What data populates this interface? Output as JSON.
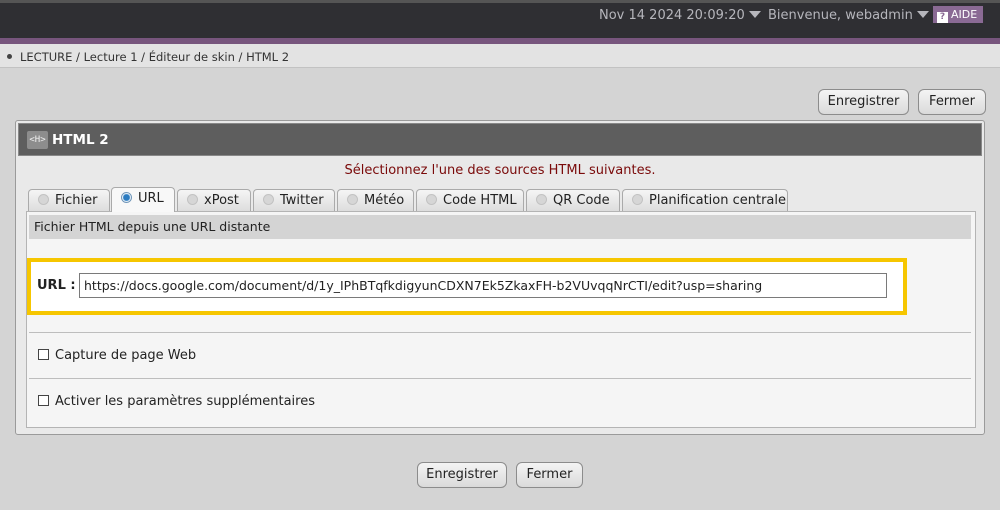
{
  "header": {
    "datetime": "Nov 14 2024 20:09:20",
    "welcome": "Bienvenue, webadmin",
    "help_label": "AIDE",
    "help_icon": "?"
  },
  "breadcrumb": "LECTURE / Lecture 1 / Éditeur de skin / HTML 2",
  "toolbar": {
    "save_label": "Enregistrer",
    "close_label": "Fermer"
  },
  "panel": {
    "icon_text": "<H>",
    "title": "HTML 2",
    "notice": "Sélectionnez l'une des sources HTML suivantes.",
    "tabs": [
      {
        "label": "Fichier"
      },
      {
        "label": "URL"
      },
      {
        "label": "xPost"
      },
      {
        "label": "Twitter"
      },
      {
        "label": "Météo"
      },
      {
        "label": "Code HTML"
      },
      {
        "label": "QR Code"
      },
      {
        "label": "Planification centrale"
      }
    ],
    "active_tab": "URL",
    "section_title": "Fichier HTML depuis une URL distante",
    "url_label": "URL :",
    "url_value": "https://docs.google.com/document/d/1y_IPhBTqfkdigyunCDXN7Ek5ZkaxFH-b2VUvqqNrCTI/edit?usp=sharing",
    "options": [
      {
        "label": "Capture de page Web",
        "checked": false
      },
      {
        "label": "Activer les paramètres supplémentaires",
        "checked": false
      }
    ]
  },
  "footer": {
    "save_label": "Enregistrer",
    "close_label": "Fermer"
  },
  "colors": {
    "accent": "#77557d",
    "highlight": "#f6c600",
    "notice": "#7a0a0a"
  }
}
